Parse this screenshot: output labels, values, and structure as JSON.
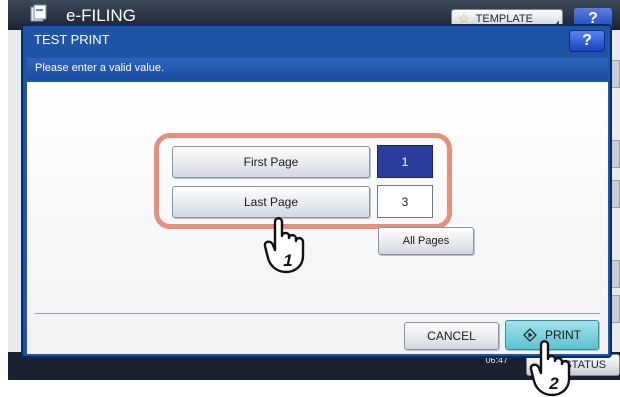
{
  "app": {
    "title": "e-FILING",
    "template_label": "TEMPLATE",
    "help_label": "?",
    "clock_date": "",
    "clock_time": "06:47",
    "job_status_label": "JOB STATUS"
  },
  "dialog": {
    "title": "TEST PRINT",
    "help_label": "?",
    "message": "Please enter a valid value."
  },
  "range": {
    "first_page_label": "First Page",
    "first_page_value": "1",
    "last_page_label": "Last Page",
    "last_page_value": "3",
    "all_pages_label": "All Pages"
  },
  "actions": {
    "cancel_label": "CANCEL",
    "print_label": "PRINT"
  },
  "callouts": {
    "step_1": "1",
    "step_2": "2"
  },
  "colors": {
    "dialog_blue": "#1f55a6",
    "selected_value_bg": "#2b3d9b",
    "highlight_ring": "#e58f7c",
    "print_button": "#7fd1dc"
  },
  "icons": [
    "efiling-logo-icon",
    "star-icon",
    "print-start-icon",
    "hand-pointer-icon"
  ]
}
